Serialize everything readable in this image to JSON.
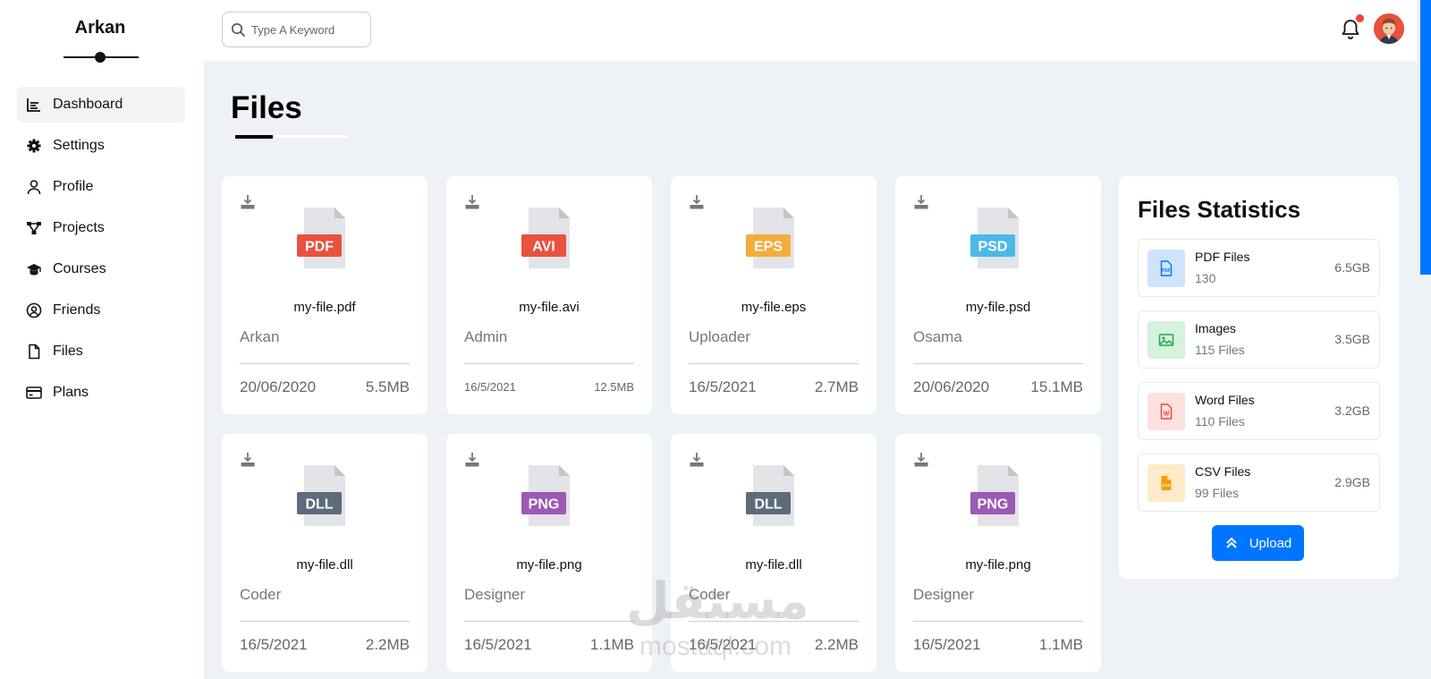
{
  "brand": {
    "name": "Arkan"
  },
  "sidebar": {
    "items": [
      {
        "label": "Dashboard",
        "icon": "chart-icon",
        "active": true
      },
      {
        "label": "Settings",
        "icon": "gear-icon"
      },
      {
        "label": "Profile",
        "icon": "user-icon"
      },
      {
        "label": "Projects",
        "icon": "diagram-icon"
      },
      {
        "label": "Courses",
        "icon": "graduation-cap-icon"
      },
      {
        "label": "Friends",
        "icon": "user-circle-icon"
      },
      {
        "label": "Files",
        "icon": "file-icon"
      },
      {
        "label": "Plans",
        "icon": "credit-card-icon"
      }
    ]
  },
  "header": {
    "search_placeholder": "Type A Keyword"
  },
  "page": {
    "title": "Files"
  },
  "files": [
    {
      "name": "my-file.pdf",
      "type": "PDF",
      "color": "#e9523f",
      "owner": "Arkan",
      "date": "20/06/2020",
      "size": "5.5MB"
    },
    {
      "name": "my-file.avi",
      "type": "AVI",
      "color": "#e9523f",
      "owner": "Admin",
      "date": "16/5/2021",
      "size": "12.5MB"
    },
    {
      "name": "my-file.eps",
      "type": "EPS",
      "color": "#f2ad3c",
      "owner": "Uploader",
      "date": "16/5/2021",
      "size": "2.7MB"
    },
    {
      "name": "my-file.psd",
      "type": "PSD",
      "color": "#4db8e6",
      "owner": "Osama",
      "date": "20/06/2020",
      "size": "15.1MB"
    },
    {
      "name": "my-file.dll",
      "type": "DLL",
      "color": "#5d6b7b",
      "owner": "Coder",
      "date": "16/5/2021",
      "size": "2.2MB"
    },
    {
      "name": "my-file.png",
      "type": "PNG",
      "color": "#9c59b6",
      "owner": "Designer",
      "date": "16/5/2021",
      "size": "1.1MB"
    },
    {
      "name": "my-file.dll",
      "type": "DLL",
      "color": "#5d6b7b",
      "owner": "Coder",
      "date": "16/5/2021",
      "size": "2.2MB"
    },
    {
      "name": "my-file.png",
      "type": "PNG",
      "color": "#9c59b6",
      "owner": "Designer",
      "date": "16/5/2021",
      "size": "1.1MB"
    }
  ],
  "stats": {
    "title": "Files Statistics",
    "items": [
      {
        "name": "PDF Files",
        "count": "130",
        "size": "6.5GB",
        "icon": "pdf-file-icon",
        "color": "#0075ff",
        "bg": "#cfe3fd"
      },
      {
        "name": "Images",
        "count": "115 Files",
        "size": "3.5GB",
        "icon": "image-icon",
        "color": "#22a94a",
        "bg": "#d4f2dc"
      },
      {
        "name": "Word Files",
        "count": "110 Files",
        "size": "3.2GB",
        "icon": "word-file-icon",
        "color": "#f44336",
        "bg": "#fde0de"
      },
      {
        "name": "CSV Files",
        "count": "99 Files",
        "size": "2.9GB",
        "icon": "csv-file-icon",
        "color": "#f59e0b",
        "bg": "#fdebc9"
      }
    ],
    "upload_label": "Upload"
  },
  "watermark": {
    "arabic": "مستقل",
    "latin": "mostaql.com"
  }
}
